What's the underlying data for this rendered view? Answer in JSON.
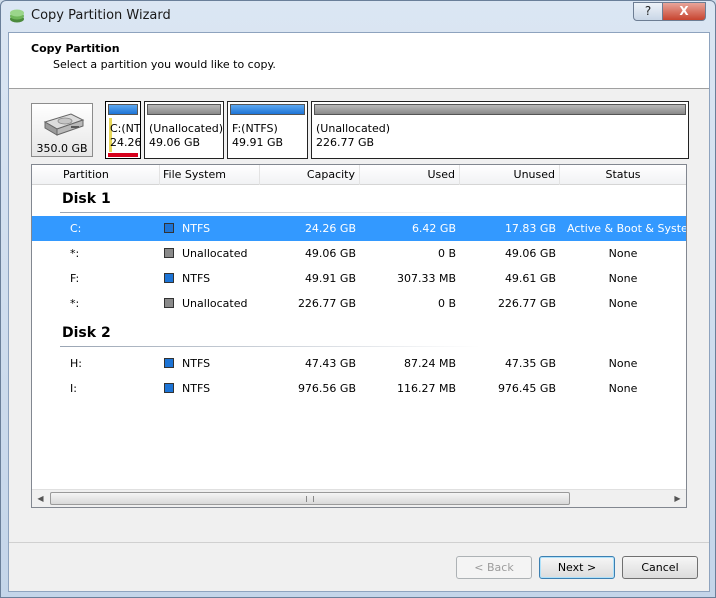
{
  "window": {
    "title": "Copy Partition Wizard",
    "help_label": "?",
    "close_label": "X"
  },
  "header": {
    "title": "Copy Partition",
    "subtitle": "Select a partition you would like to copy."
  },
  "disk_map": {
    "disk_size": "350.0 GB",
    "partitions": [
      {
        "line1": "C:(NTF",
        "line2": "24.26",
        "type": "ntfs",
        "selected": true
      },
      {
        "line1": "(Unallocated)",
        "line2": "49.06 GB",
        "type": "unallocated"
      },
      {
        "line1": "F:(NTFS)",
        "line2": "49.91 GB",
        "type": "ntfs"
      },
      {
        "line1": "(Unallocated)",
        "line2": "226.77 GB",
        "type": "unallocated"
      }
    ]
  },
  "table": {
    "columns": [
      "Partition",
      "File System",
      "Capacity",
      "Used",
      "Unused",
      "Status"
    ],
    "groups": [
      {
        "title": "Disk 1",
        "rows": [
          {
            "partition": "C:",
            "fs": "NTFS",
            "fs_type": "ntfs",
            "capacity": "24.26 GB",
            "used": "6.42 GB",
            "unused": "17.83 GB",
            "status": "Active & Boot & System",
            "selected": true
          },
          {
            "partition": "*:",
            "fs": "Unallocated",
            "fs_type": "unallocated",
            "capacity": "49.06 GB",
            "used": "0 B",
            "unused": "49.06 GB",
            "status": "None"
          },
          {
            "partition": "F:",
            "fs": "NTFS",
            "fs_type": "ntfs",
            "capacity": "49.91 GB",
            "used": "307.33 MB",
            "unused": "49.61 GB",
            "status": "None"
          },
          {
            "partition": "*:",
            "fs": "Unallocated",
            "fs_type": "unallocated",
            "capacity": "226.77 GB",
            "used": "0 B",
            "unused": "226.77 GB",
            "status": "None"
          }
        ]
      },
      {
        "title": "Disk 2",
        "rows": [
          {
            "partition": "H:",
            "fs": "NTFS",
            "fs_type": "ntfs",
            "capacity": "47.43 GB",
            "used": "87.24 MB",
            "unused": "47.35 GB",
            "status": "None"
          },
          {
            "partition": "I:",
            "fs": "NTFS",
            "fs_type": "ntfs",
            "capacity": "976.56 GB",
            "used": "116.27 MB",
            "unused": "976.45 GB",
            "status": "None"
          }
        ]
      }
    ]
  },
  "buttons": {
    "back": "< Back",
    "next": "Next >",
    "cancel": "Cancel"
  },
  "colors": {
    "selection": "#3399ff",
    "ntfs": "#1d74d6",
    "unallocated": "#8a8a8a",
    "used_marker": "#d6001c"
  }
}
